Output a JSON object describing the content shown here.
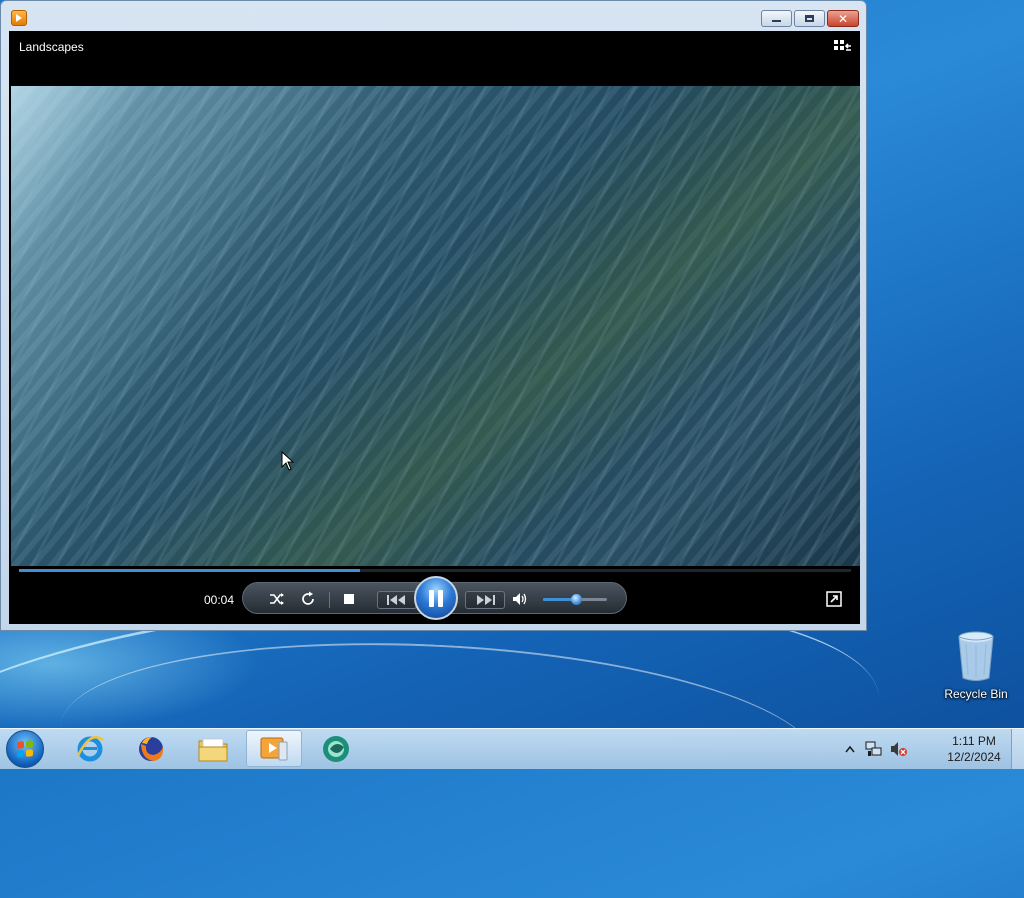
{
  "player": {
    "media_title": "Landscapes",
    "elapsed_time": "00:04",
    "seek_progress": 0.41,
    "volume_level": 0.52,
    "state": "playing",
    "accent_color": "#3f8ed6"
  },
  "desktop": {
    "recycle_bin_label": "Recycle Bin"
  },
  "taskbar": {
    "items": [
      {
        "name": "internet-explorer",
        "icon": "ie-icon"
      },
      {
        "name": "firefox",
        "icon": "firefox-icon"
      },
      {
        "name": "windows-explorer",
        "icon": "folder-icon"
      },
      {
        "name": "windows-media-player",
        "icon": "media-player-icon",
        "active": true
      },
      {
        "name": "other-app",
        "icon": "green-app-icon"
      }
    ],
    "clock_time": "1:11 PM",
    "clock_date": "12/2/2024"
  }
}
